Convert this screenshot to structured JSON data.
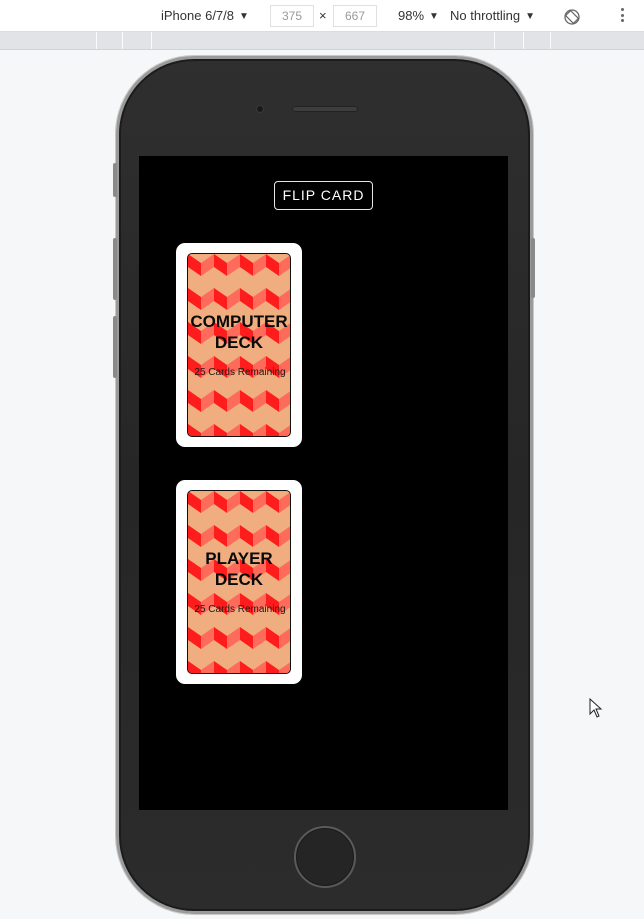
{
  "toolbar": {
    "device": "iPhone 6/7/8",
    "width": "375",
    "times": "×",
    "height": "667",
    "zoom": "98%",
    "throttling": "No throttling"
  },
  "app": {
    "flip_button": "FLIP CARD",
    "computer_deck": {
      "title_line1": "COMPUTER",
      "title_line2": "DECK",
      "count": "25 Cards Remaining"
    },
    "player_deck": {
      "title_line1": "PLAYER",
      "title_line2": "DECK",
      "count": "25 Cards Remaining"
    }
  },
  "colors": {
    "screen_bg": "#000000",
    "card_red": "#ff1c1c",
    "card_pink": "#ff6b5a",
    "card_tan": "#efad80"
  }
}
